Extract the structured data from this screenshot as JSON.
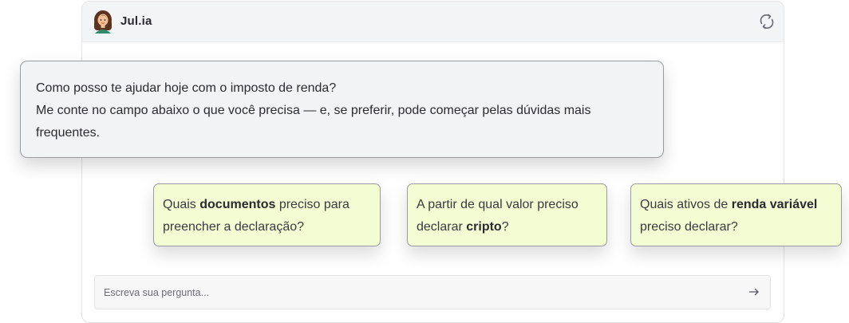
{
  "header": {
    "bot_name": "Jul.ia",
    "avatar_icon": "woman-avatar-icon",
    "refresh_icon": "refresh-icon"
  },
  "greeting": {
    "line1": "Como posso te ajudar hoje com o imposto de renda?",
    "line2": "Me conte no campo abaixo o que você precisa — e, se preferir, pode começar pelas dúvidas mais frequentes."
  },
  "suggestions": [
    {
      "pre": "Quais ",
      "bold": "documentos",
      "post": " preciso para preencher a declaração?"
    },
    {
      "pre": "A partir de qual valor preciso declarar ",
      "bold": "cripto",
      "post": "?"
    },
    {
      "pre": "Quais ativos de ",
      "bold": "renda variável",
      "post": " preciso declarar?"
    }
  ],
  "input": {
    "placeholder": "Escreva sua pergunta...",
    "value": "",
    "send_icon": "arrow-right-icon"
  },
  "colors": {
    "header_bg": "#f3f4f6",
    "chip_bg": "#f3fcd2",
    "bubble_bg": "#f2f3f5"
  }
}
